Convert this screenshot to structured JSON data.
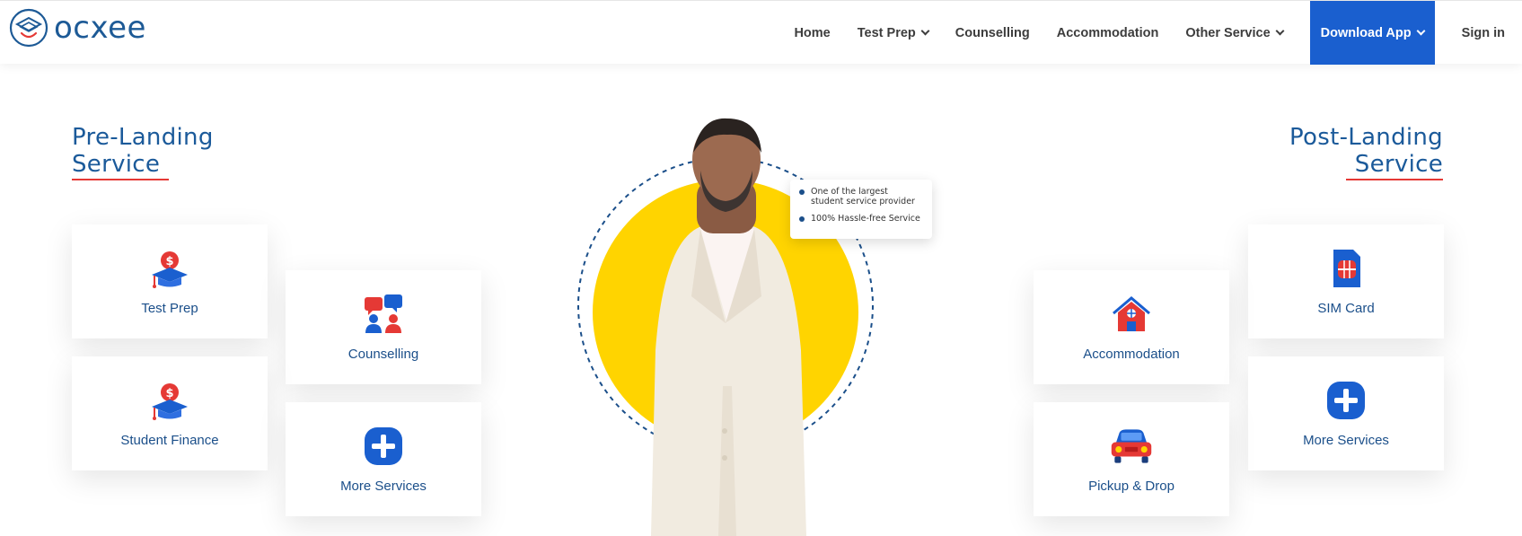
{
  "brand": {
    "name": "ocxee"
  },
  "nav": {
    "items": [
      {
        "label": "Home",
        "dropdown": false
      },
      {
        "label": "Test Prep",
        "dropdown": true
      },
      {
        "label": "Counselling",
        "dropdown": false
      },
      {
        "label": "Accommodation",
        "dropdown": false
      },
      {
        "label": "Other Service",
        "dropdown": true
      }
    ],
    "download_label": "Download App",
    "signin_label": "Sign in"
  },
  "pre_landing": {
    "title_line1": "Pre-Landing",
    "title_line2": "Service",
    "cards": [
      {
        "label": "Test Prep",
        "icon": "grad-cap-dollar-icon"
      },
      {
        "label": "Counselling",
        "icon": "chat-people-icon"
      },
      {
        "label": "Student Finance",
        "icon": "grad-cap-dollar-icon"
      },
      {
        "label": "More Services",
        "icon": "plus-icon"
      }
    ]
  },
  "post_landing": {
    "title_line1": "Post-Landing",
    "title_line2": "Service",
    "cards": [
      {
        "label": "SIM Card",
        "icon": "sim-card-icon"
      },
      {
        "label": "Accommodation",
        "icon": "house-icon"
      },
      {
        "label": "More Services",
        "icon": "plus-icon"
      },
      {
        "label": "Pickup & Drop",
        "icon": "car-icon"
      }
    ]
  },
  "hero": {
    "points": [
      "One of the largest student service provider",
      "100% Hassle-free Service"
    ]
  },
  "colors": {
    "brand_blue": "#1b5a9a",
    "button_blue": "#1a5fcf",
    "accent_red": "#e53935",
    "hero_yellow": "#ffd400"
  }
}
